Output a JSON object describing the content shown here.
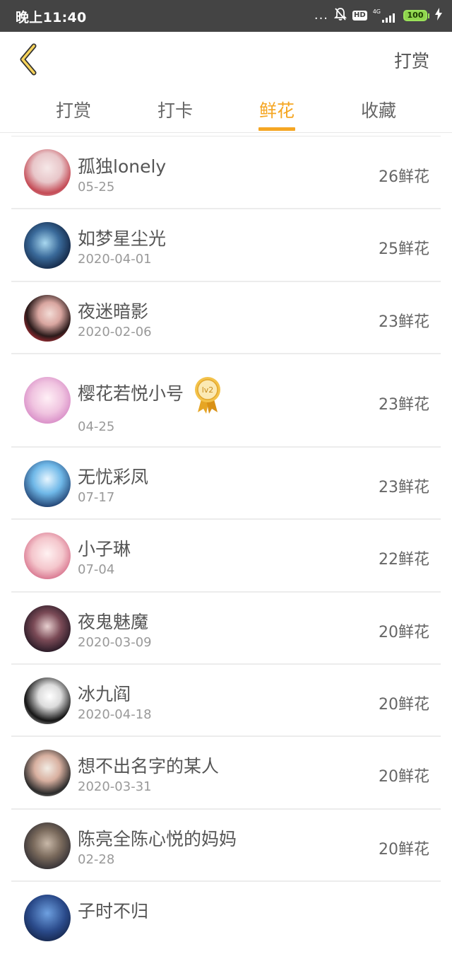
{
  "status_bar": {
    "time": "晚上11:40",
    "dots": "...",
    "hd": "HD",
    "network": "4G",
    "battery": "100"
  },
  "header": {
    "action": "打赏"
  },
  "tabs": [
    {
      "label": "打赏",
      "active": false
    },
    {
      "label": "打卡",
      "active": false
    },
    {
      "label": "鲜花",
      "active": true
    },
    {
      "label": "收藏",
      "active": false
    }
  ],
  "list": [
    {
      "name": "孤独lonely",
      "date": "05-25",
      "count": "26鲜花"
    },
    {
      "name": "如梦星尘光",
      "date": "2020-04-01",
      "count": "25鲜花"
    },
    {
      "name": "夜迷暗影",
      "date": "2020-02-06",
      "count": "23鲜花"
    },
    {
      "name": "樱花若悦小号",
      "date": "04-25",
      "count": "23鲜花",
      "badge": "lv2"
    },
    {
      "name": "无忧彩凤",
      "date": "07-17",
      "count": "23鲜花"
    },
    {
      "name": "小子琳",
      "date": "07-04",
      "count": "22鲜花"
    },
    {
      "name": "夜鬼魅魔",
      "date": "2020-03-09",
      "count": "20鲜花"
    },
    {
      "name": "冰九阎",
      "date": "2020-04-18",
      "count": "20鲜花"
    },
    {
      "name": "想不出名字的某人",
      "date": "2020-03-31",
      "count": "20鲜花"
    },
    {
      "name": "陈亮全陈心悦的妈妈",
      "date": "02-28",
      "count": "20鲜花"
    },
    {
      "name": "子时不归",
      "date": "",
      "count": ""
    }
  ],
  "colors": {
    "accent": "#f5a623",
    "status_bar": "#444444",
    "battery": "#8fd44d"
  }
}
